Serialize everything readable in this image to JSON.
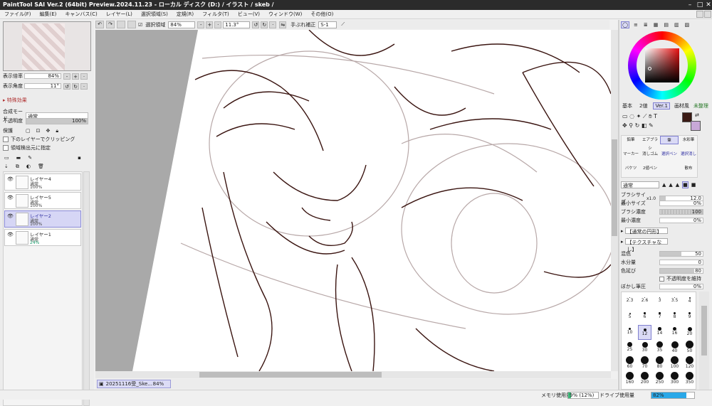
{
  "window": {
    "title": "PaintTool SAI Ver.2 (64bit) Preview.2024.11.23 - ローカル ディスク (D:) / イラスト / skeb /"
  },
  "menu": [
    "ファイル(F)",
    "編集(E)",
    "キャンバス(C)",
    "レイヤー(L)",
    "選択領域(S)",
    "定規(R)",
    "フィルタ(T)",
    "ビュー(V)",
    "ウィンドウ(W)",
    "その他(O)"
  ],
  "navigator": {
    "zoom_label": "表示倍率",
    "zoom_value": "84%",
    "angle_label": "表示角度",
    "angle_value": "11°"
  },
  "effects": {
    "label": "特殊効果"
  },
  "layer_props": {
    "blend_label": "合成モード",
    "blend_value": "通常",
    "opacity_label": "不透明度",
    "opacity_value": "100%",
    "protect_label": "保護",
    "clip_label": "下のレイヤーでクリッピング",
    "detect_label": "領域検出元に指定"
  },
  "layers": [
    {
      "name": "レイヤー4",
      "mode": "通常",
      "opacity": "100%"
    },
    {
      "name": "レイヤー5",
      "mode": "通常",
      "opacity": "100%"
    },
    {
      "name": "レイヤー2",
      "mode": "通常",
      "opacity": "100%"
    },
    {
      "name": "レイヤー1",
      "mode": "通常",
      "opacity": "24%"
    }
  ],
  "toolbar": {
    "selection_label": "選択領域",
    "zoom": "84%",
    "angle": "11.3°",
    "stabilizer_label": "手ぶれ補正",
    "stabilizer_value": "S-1"
  },
  "color": {
    "main": "#3a1a14",
    "sub": "#c8a8d8",
    "hue_selected": "#b01818"
  },
  "color_tabs": [
    "基本",
    "2値",
    "Ver.1",
    "画材風",
    "未整理"
  ],
  "tools": [
    [
      "鉛筆",
      "エアブラシ",
      "筆",
      "水彩筆"
    ],
    [
      "マーカー",
      "消しゴム",
      "選択ペン",
      "選択消し"
    ],
    [
      "バケツ",
      "2値ペン",
      "",
      ""
    ]
  ],
  "tools_extra": {
    "blur_label": "散布"
  },
  "brush": {
    "mode": "通常",
    "size_label": "ブラシサイズ",
    "size_mult": "x1.0",
    "size_value": "12.0",
    "min_size_label": "最小サイズ",
    "min_size_value": "0%",
    "density_label": "ブラシ濃度",
    "density_value": "100",
    "min_density_label": "最小濃度",
    "min_density_value": "0%",
    "shape_label": "【通常の円形】",
    "texture_label": "【テクスチャなし】",
    "mix_label": "混色",
    "mix_value": "50",
    "water_label": "水分量",
    "water_value": "0",
    "stretch_label": "色延び",
    "stretch_value": "80",
    "keep_opacity_label": "不透明度を維持",
    "blur_label": "ぼかし筆圧",
    "blur_value": "0%"
  },
  "brush_sizes": [
    [
      {
        "l": "2.3",
        "d": 1
      },
      {
        "l": "2.6",
        "d": 1
      },
      {
        "l": "3",
        "d": 1.5
      },
      {
        "l": "3.5",
        "d": 1.5
      },
      {
        "l": "4",
        "d": 2
      }
    ],
    [
      {
        "l": "5",
        "d": 2
      },
      {
        "l": "6",
        "d": 2.5
      },
      {
        "l": "7",
        "d": 2.5
      },
      {
        "l": "8",
        "d": 3
      },
      {
        "l": "9",
        "d": 3
      }
    ],
    [
      {
        "l": "10",
        "d": 3.5
      },
      {
        "l": "12",
        "d": 4
      },
      {
        "l": "14",
        "d": 4.5
      },
      {
        "l": "16",
        "d": 5
      },
      {
        "l": "20",
        "d": 6
      }
    ],
    [
      {
        "l": "25",
        "d": 7
      },
      {
        "l": "30",
        "d": 8
      },
      {
        "l": "35",
        "d": 9
      },
      {
        "l": "40",
        "d": 10
      },
      {
        "l": "50",
        "d": 11
      }
    ],
    [
      {
        "l": "60",
        "d": 11
      },
      {
        "l": "70",
        "d": 11
      },
      {
        "l": "80",
        "d": 11
      },
      {
        "l": "100",
        "d": 11
      },
      {
        "l": "120",
        "d": 11
      }
    ],
    [
      {
        "l": "160",
        "d": 11
      },
      {
        "l": "200",
        "d": 11
      },
      {
        "l": "250",
        "d": 11
      },
      {
        "l": "300",
        "d": 11
      },
      {
        "l": "350",
        "d": 11
      }
    ]
  ],
  "doc_tab": {
    "name": "20251116受_Ske...",
    "zoom": "84%"
  },
  "status": {
    "mem_label": "メモリ使用量",
    "mem_value": "9% (12%)",
    "mem_fill": 0.09,
    "drive_label": "ドライブ使用量",
    "drive_value": "82%",
    "drive_fill": 0.82
  }
}
